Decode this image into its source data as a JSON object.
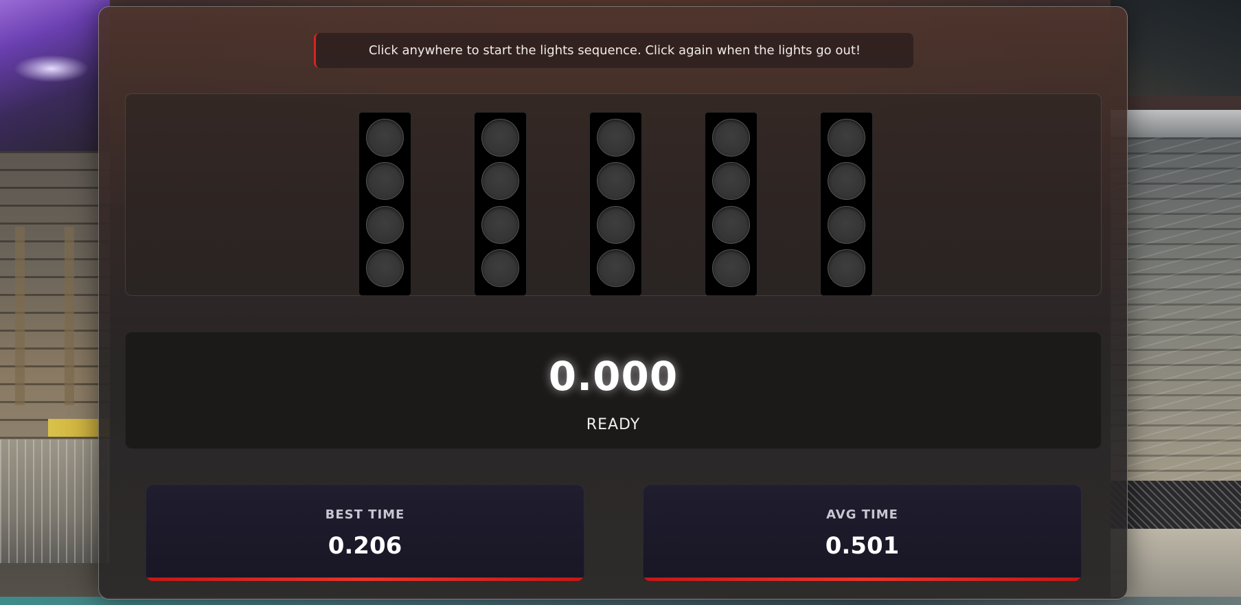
{
  "instruction": "Click anywhere to start the lights sequence. Click again when the lights go out!",
  "lights": {
    "columns": 5,
    "bulbs_per_column": 4,
    "lit_count": 0
  },
  "timer": {
    "value": "0.000",
    "status": "READY"
  },
  "stats": {
    "best": {
      "label": "BEST TIME",
      "value": "0.206"
    },
    "avg": {
      "label": "AVG TIME",
      "value": "0.501"
    }
  },
  "colors": {
    "accent": "#e8342c",
    "card_bg": "#1f1d2e",
    "bulb_off": "#353535"
  }
}
